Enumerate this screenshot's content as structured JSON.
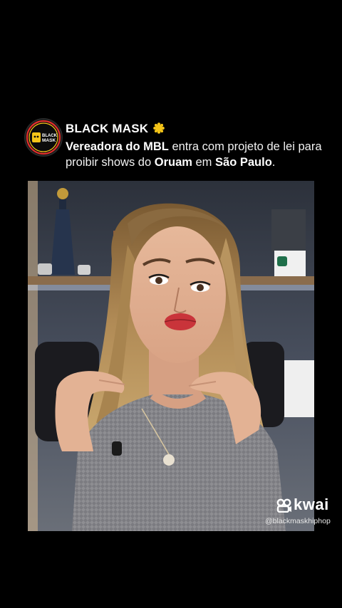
{
  "post": {
    "account_name": "BLACK MASK",
    "avatar_lines": [
      "BLACK",
      "MASK"
    ],
    "verified": true,
    "headline": {
      "segments": [
        {
          "text": "Vereadora do MBL",
          "bold": true
        },
        {
          "text": " entra com projeto de lei para proibir shows do ",
          "bold": false
        },
        {
          "text": "Oruam",
          "bold": true
        },
        {
          "text": " em ",
          "bold": false
        },
        {
          "text": "São Paulo",
          "bold": true
        },
        {
          "text": ".",
          "bold": false
        }
      ]
    }
  },
  "video": {
    "subject": "person-speaking"
  },
  "watermark": {
    "brand": "kwai",
    "handle": "@blackmaskhiphop"
  },
  "colors": {
    "background": "#000000",
    "verified_badge": "#f5c518",
    "avatar_ring": "#e0302d",
    "avatar_ring_inner": "#f5c518"
  }
}
